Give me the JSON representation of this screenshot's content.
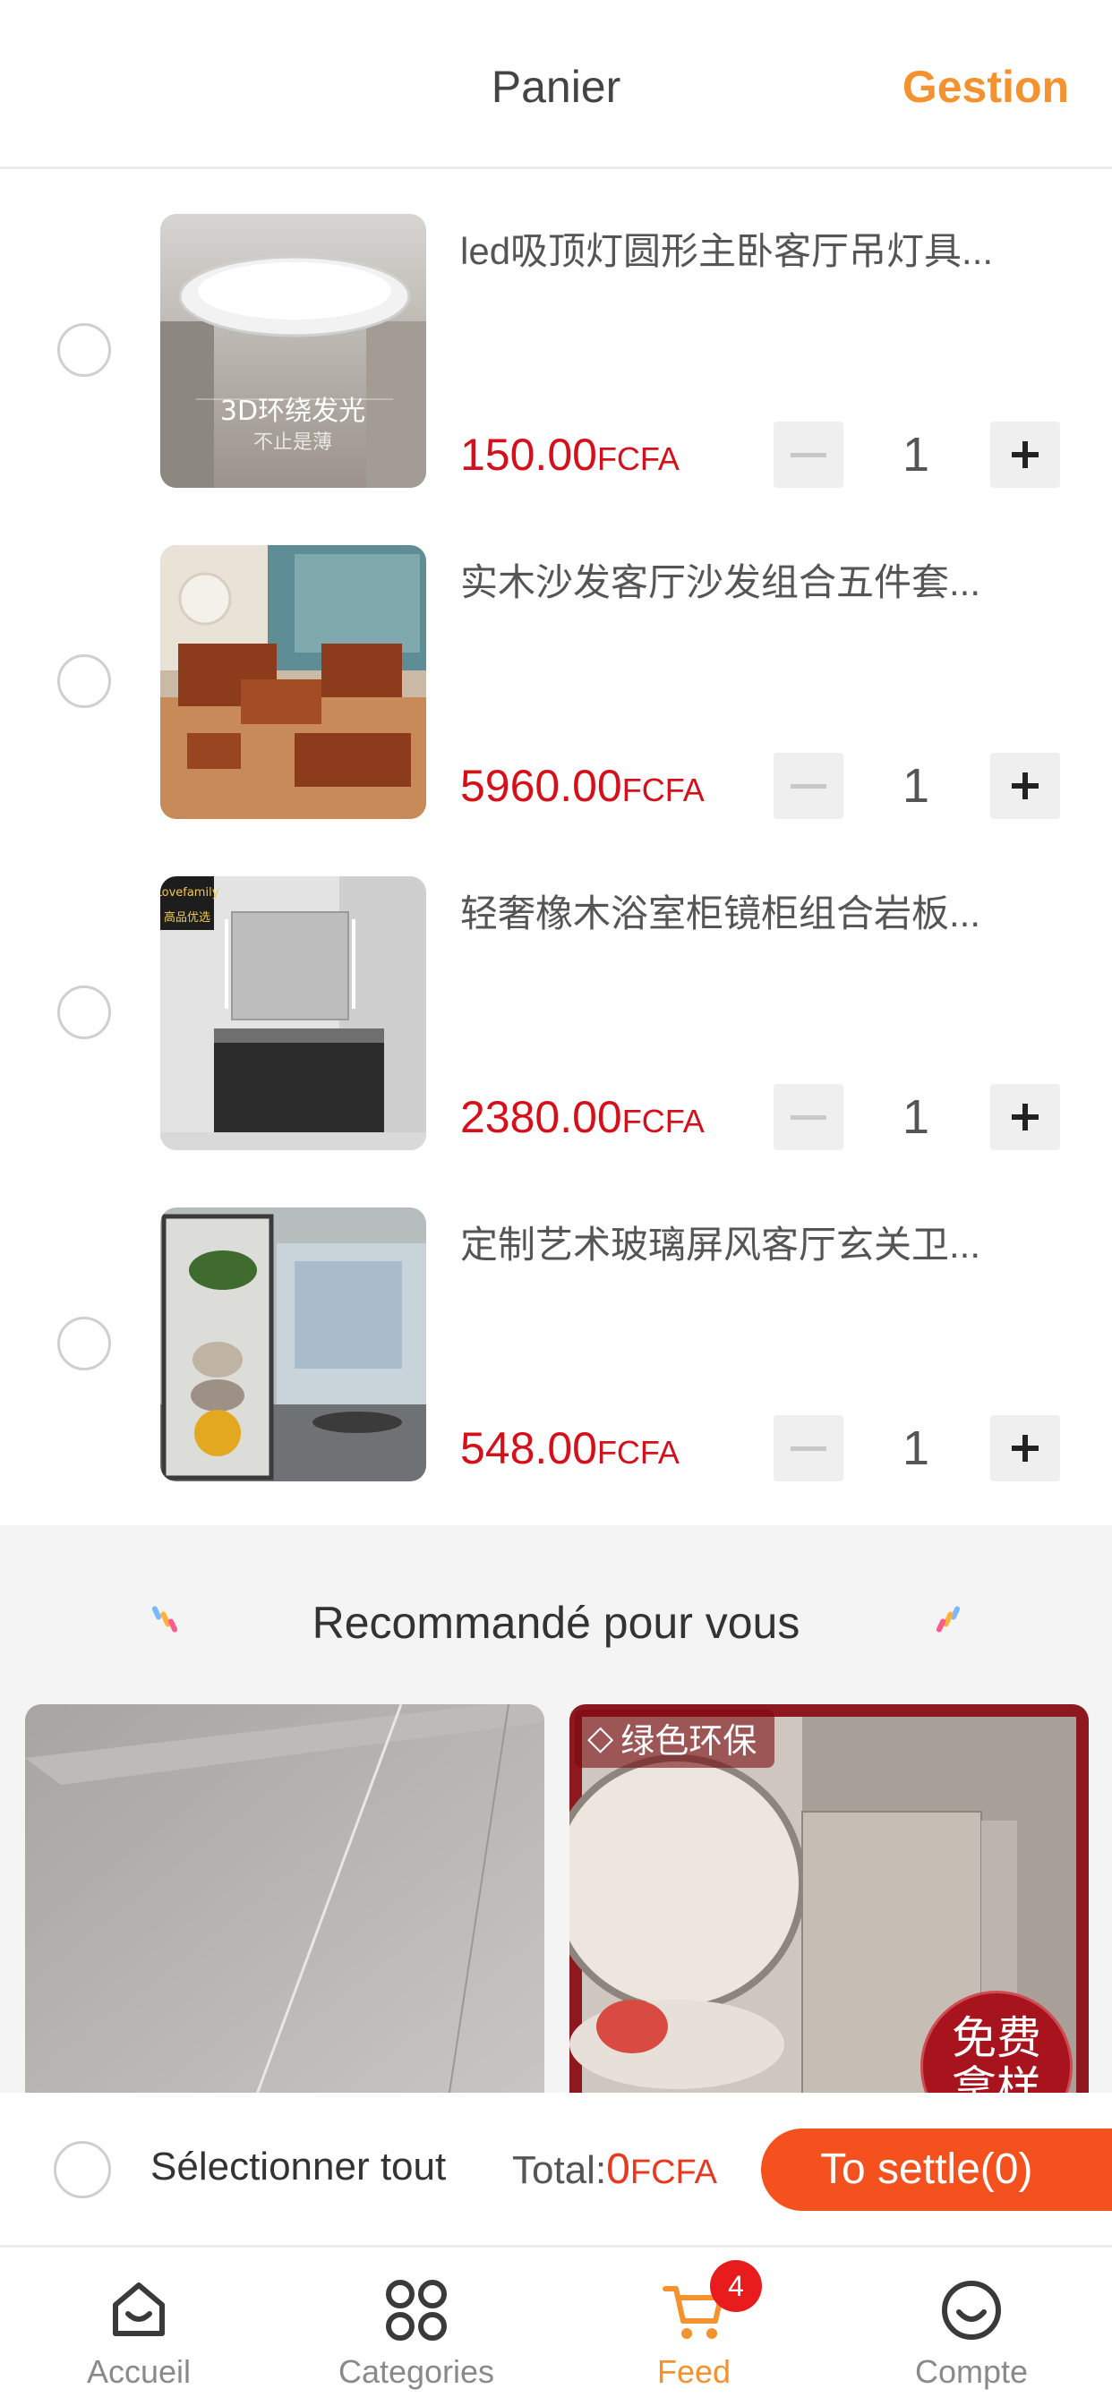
{
  "header": {
    "title": "Panier",
    "manage_label": "Gestion"
  },
  "cart": {
    "items": [
      {
        "title": "led吸顶灯圆形主卧客厅吊灯具...",
        "price": "150.00",
        "currency": "FCFA",
        "qty": "1",
        "thumb_line1": "3D环绕发光",
        "thumb_line2": "不止是薄"
      },
      {
        "title": "实木沙发客厅沙发组合五件套...",
        "price": "5960.00",
        "currency": "FCFA",
        "qty": "1"
      },
      {
        "title": "轻奢橡木浴室柜镜柜组合岩板...",
        "price": "2380.00",
        "currency": "FCFA",
        "qty": "1",
        "thumb_brand": "Lovefamily",
        "thumb_tag": "高品优选"
      },
      {
        "title": "定制艺术玻璃屏风客厅玄关卫...",
        "price": "548.00",
        "currency": "FCFA",
        "qty": "1"
      }
    ]
  },
  "recommend": {
    "title": "Recommandé pour vous",
    "cards": [
      {
        "tag": ""
      },
      {
        "tag": "绿色环保",
        "badge_line1": "免费",
        "badge_line2": "拿样"
      }
    ]
  },
  "settle": {
    "select_all_label": "Sélectionner tout",
    "total_label": "Total:",
    "total_value": "0",
    "total_currency": "FCFA",
    "button_label": "To settle(0)"
  },
  "tabbar": {
    "tabs": [
      {
        "label": "Accueil",
        "icon": "home-icon"
      },
      {
        "label": "Categories",
        "icon": "categories-icon"
      },
      {
        "label": "Feed",
        "icon": "cart-icon",
        "badge": "4"
      },
      {
        "label": "Compte",
        "icon": "account-icon"
      }
    ]
  },
  "colors": {
    "accent": "#f3922f",
    "price": "#d6101b",
    "settle_button": "#f4511e",
    "badge": "#e81c1c"
  }
}
